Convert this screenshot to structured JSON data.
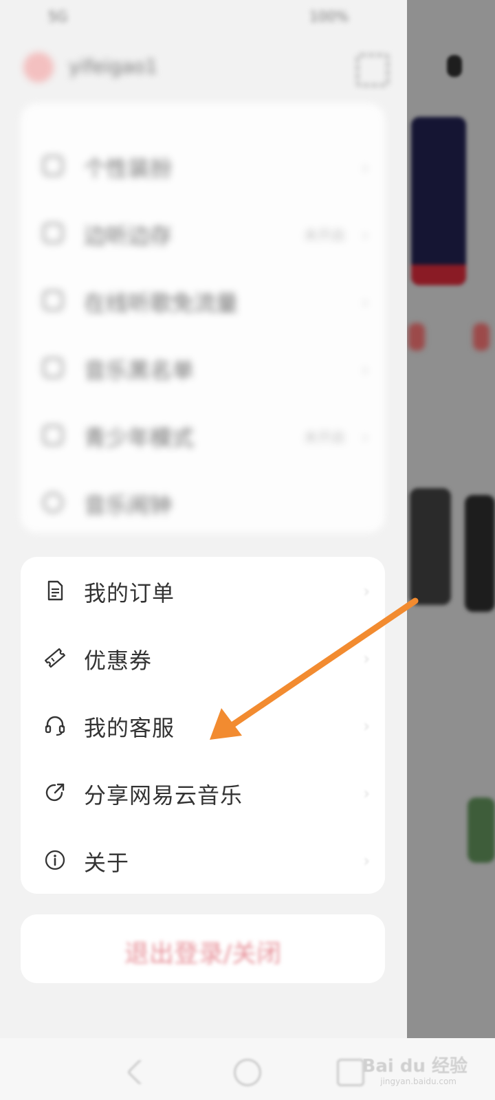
{
  "status_bar": {
    "left_text": "5G",
    "right_text": "100%"
  },
  "header": {
    "username": "yifeigao1"
  },
  "blurred_menu": [
    {
      "label": "个性装扮",
      "extra": "",
      "icon": "shirt-icon"
    },
    {
      "label": "边听边存",
      "extra": "未开启",
      "icon": "cloud-icon"
    },
    {
      "label": "在线听歌免流量",
      "extra": "",
      "icon": "sim-icon"
    },
    {
      "label": "音乐黑名单",
      "extra": "",
      "icon": "block-icon"
    },
    {
      "label": "青少年模式",
      "extra": "未开启",
      "icon": "shield-icon"
    },
    {
      "label": "音乐闹钟",
      "extra": "",
      "icon": "alarm-icon"
    }
  ],
  "menu": {
    "orders": "我的订单",
    "coupons": "优惠券",
    "customer_service": "我的客服",
    "share": "分享网易云音乐",
    "about": "关于"
  },
  "logout": "退出登录/关闭",
  "watermark": {
    "brand": "Bai du 经验",
    "url": "jingyan.baidu.com"
  },
  "colors": {
    "arrow": "#f28b30",
    "logout_text": "#e7929a"
  }
}
